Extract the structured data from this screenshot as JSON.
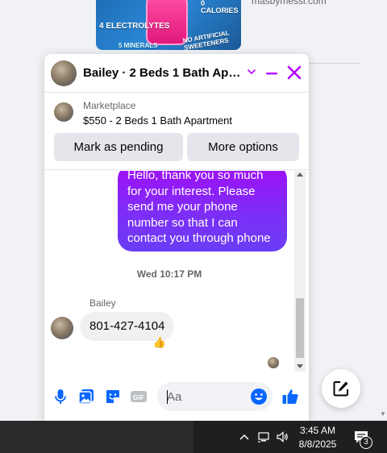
{
  "colors": {
    "accent": "#a00ff7",
    "bubble_gradient_start": "#a00ff7",
    "bubble_gradient_end": "#6a3df5",
    "icon_blue": "#0866ff",
    "header_icon": "#b404ff",
    "taskbar": "#1f1f1f"
  },
  "feed": {
    "ad_texts": [
      "4 ELECTROLYTES",
      "0 CALORIES",
      "NO ARTIFICIAL SWEETENERS",
      "5 MINERALS"
    ],
    "site": "masbymessi.com"
  },
  "chat": {
    "title": "Bailey · 2 Beds 1 Bath Apartment",
    "icons": {
      "options": "chevron-down-icon",
      "minimize": "minimize-icon",
      "close": "close-icon"
    },
    "marketplace": {
      "label": "Marketplace",
      "item": "$550 - 2 Beds 1 Bath Apartment",
      "mark_pending_label": "Mark as pending",
      "more_options_label": "More options"
    },
    "messages": {
      "outgoing_text": "Hello, thank you so much for your interest. Please send me your phone number so that I can contact you through phone",
      "timestamp": "Wed 10:17 PM",
      "sender_name": "Bailey",
      "incoming_text": "801-427-4104",
      "reaction": "👍"
    },
    "composer": {
      "placeholder": "Aa",
      "icons": [
        "microphone-icon",
        "image-icon",
        "sticker-icon",
        "gif-icon",
        "emoji-icon",
        "thumbs-up-icon"
      ]
    }
  },
  "taskbar": {
    "time": "3:45 AM",
    "date": "8/8/2025",
    "notification_count": "3",
    "icons": [
      "chevron-up-icon",
      "network-icon",
      "volume-icon",
      "notification-icon"
    ]
  }
}
